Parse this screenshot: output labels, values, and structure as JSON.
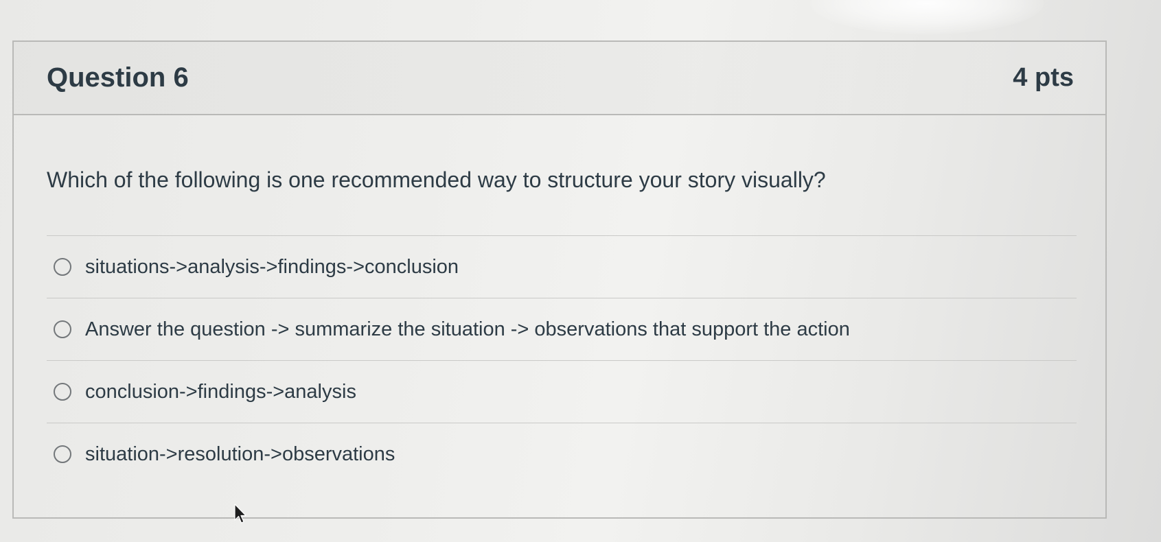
{
  "question": {
    "title": "Question 6",
    "points": "4 pts",
    "text": "Which of the following is one recommended way to structure your story visually?"
  },
  "answers": [
    {
      "label": "situations->analysis->findings->conclusion",
      "selected": false
    },
    {
      "label": "Answer the question -> summarize the situation -> observations that support the action",
      "selected": false
    },
    {
      "label": "conclusion->findings->analysis",
      "selected": false
    },
    {
      "label": "situation->resolution->observations",
      "selected": false
    }
  ],
  "cursor": {
    "icon": "mouse-pointer-icon"
  },
  "colors": {
    "text": "#2d3b45",
    "border": "#b9b9b7",
    "divider": "#c9c9c7",
    "radio": "#73777a"
  }
}
